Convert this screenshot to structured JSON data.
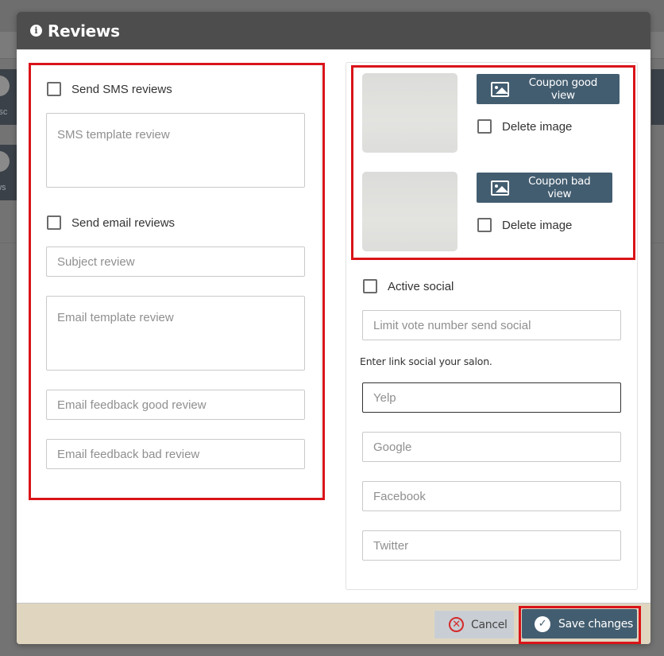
{
  "background": {
    "tiles": [
      {
        "label": "Disc"
      },
      {
        "label": "ews"
      }
    ]
  },
  "modal": {
    "title": "Reviews",
    "title_icon": "info-circle-icon"
  },
  "left_panel": {
    "sms": {
      "checkbox_label": "Send SMS reviews",
      "checked": false,
      "template_placeholder": "SMS template review",
      "template_value": ""
    },
    "email": {
      "checkbox_label": "Send email reviews",
      "checked": false,
      "subject_placeholder": "Subject review",
      "template_placeholder": "Email template review",
      "feedback_good_placeholder": "Email feedback good review",
      "feedback_bad_placeholder": "Email feedback bad review"
    }
  },
  "right_panel": {
    "coupons": [
      {
        "button_label": "Coupon good view",
        "button_icon": "image-icon",
        "delete_label": "Delete image",
        "delete_checked": false
      },
      {
        "button_label": "Coupon bad view",
        "button_icon": "image-icon",
        "delete_label": "Delete image",
        "delete_checked": false
      }
    ],
    "social": {
      "checkbox_label": "Active social",
      "checked": false,
      "limit_placeholder": "Limit vote number send social",
      "helper_text": "Enter link social your salon.",
      "links": [
        {
          "name": "yelp",
          "placeholder": "Yelp",
          "focused": true
        },
        {
          "name": "google",
          "placeholder": "Google"
        },
        {
          "name": "facebook",
          "placeholder": "Facebook"
        },
        {
          "name": "twitter",
          "placeholder": "Twitter"
        }
      ]
    }
  },
  "footer": {
    "cancel_label": "Cancel",
    "cancel_icon": "x-circle-icon",
    "save_label": "Save changes",
    "save_icon": "check-circle-icon"
  },
  "colors": {
    "header_bg": "#4d4d4d",
    "primary_button": "#435d70",
    "highlight_outline": "#d91419",
    "footer_bg": "#e0d6c0",
    "cancel_bg": "#c9ced4",
    "cancel_icon": "#d42a2a"
  }
}
